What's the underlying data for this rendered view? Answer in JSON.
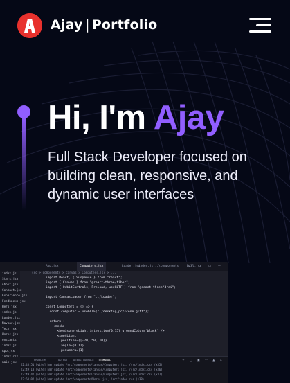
{
  "navbar": {
    "logo_letter": "A",
    "brand_name": "Ajay",
    "brand_separator": "|",
    "brand_section": "Portfolio"
  },
  "hero": {
    "greeting": "Hi, I'm ",
    "name": "Ajay",
    "subtitle": "Full Stack Developer focused on building clean, responsive, and dynamic user interfaces"
  },
  "colors": {
    "background": "#050816",
    "accent": "#915eff",
    "logo": "#e8312d"
  },
  "editor": {
    "tabs": [
      "App.jsx",
      "Computers.jsx",
      "Loader.jsx",
      "index.js ..\\components",
      "Ball.jsx"
    ],
    "breadcrumb": "src > components > canvas > Computers.jsx > ...",
    "files": [
      "index.js",
      "Stars.jsx",
      "About.jsx",
      "Contact.jsx",
      "Experience.jsx",
      "Feedbacks.jsx",
      "Hero.jsx",
      "index.js",
      "Loader.jsx",
      "Navbar.jsx",
      "Tech.jsx",
      "Works.jsx",
      "onstants",
      "index.js",
      "App.jsx",
      "index.css",
      "main.jsx"
    ],
    "code_lines": [
      "import React, { Suspense } from \"react\";",
      "import { Canvas } from \"@react-three/fiber\";",
      "import { OrbitControls, Preload, useGLTF } from \"@react-three/drei\";",
      "",
      "import CanvasLoader from \"../Loader\";",
      "",
      "const Computers = () => {",
      "  const computer = useGLTF(\"./desktop_pc/scene.gltf\");",
      "",
      "  return (",
      "    <mesh>",
      "      <hemisphereLight intensity={0.15} groundColor='black' />",
      "      <spotLight",
      "        position={[-20, 50, 10]}",
      "        angle={0.12}",
      "        penumbra={1}"
    ],
    "panel_tabs": [
      "PROBLEMS",
      "OUTPUT",
      "DEBUG CONSOLE",
      "TERMINAL"
    ],
    "terminal_lines": [
      "22:48:51 [vite] hmr update /src/components/canvas/Computers.jsx, /src/index.css (x35)",
      "22:49:18 [vite] hmr update /src/components/canvas/Computers.jsx, /src/index.css (x36)",
      "22:49:42 [vite] hmr update /src/components/canvas/Computers.jsx, /src/index.css (x37)",
      "22:50:02 [vite] hmr update /src/components/Works.jsx, /src/index.css (x38)"
    ]
  }
}
